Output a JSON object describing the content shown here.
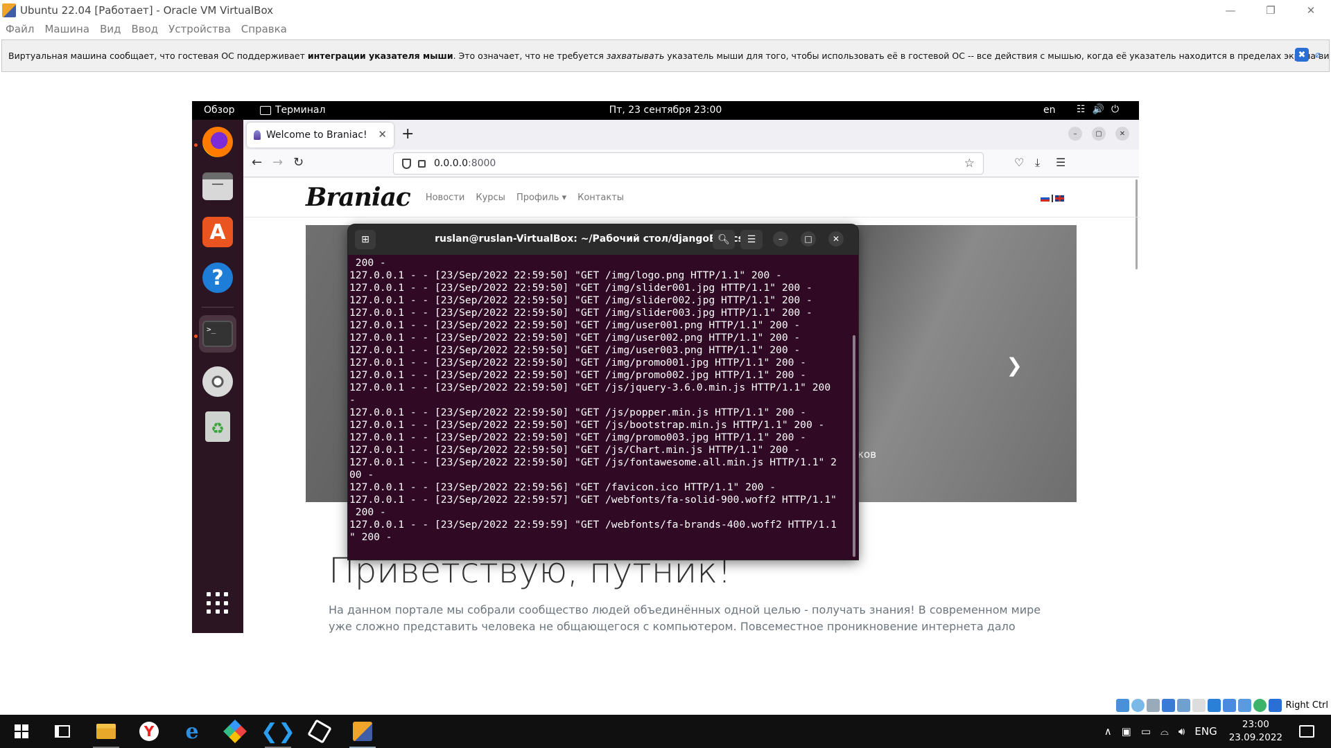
{
  "host": {
    "title": "Ubuntu 22.04 [Работает] - Oracle VM VirtualBox",
    "menu": [
      "Файл",
      "Машина",
      "Вид",
      "Ввод",
      "Устройства",
      "Справка"
    ],
    "notice": {
      "part1": "Виртуальная машина сообщает, что гостевая ОС поддерживает ",
      "bold": "интеграции указателя мыши",
      "part2": ". Это означает, что не требуется ",
      "italic": "захватывать",
      "part3": " указатель мыши для того, чтобы использовать её в гостевой ОС -- все действия с мышью, когда её указатель находится в пределах экрана виртуальной машины,"
    },
    "hostkey": "Right Ctrl"
  },
  "guest": {
    "topbar": {
      "overview": "Обзор",
      "app": "Терминал",
      "clock": "Пт, 23 сентября  23:00",
      "lang": "en"
    },
    "firefox": {
      "tab_title": "Welcome to Braniac!",
      "url_host": "0.0.0.0",
      "url_port": ":8000"
    },
    "site": {
      "logo": "Braniac",
      "nav": [
        "Новости",
        "Курсы",
        "Профиль ▾",
        "Контакты"
      ],
      "caption": "ков",
      "heading": "Приветствую, путник!",
      "lead": "На данном портале мы собрали сообщество людей объединённых одной целью - получать знания! В современном мире уже сложно представить человека не общающегося с компьютером. Повсеместное проникновение интернета дало возможность объединить людей и"
    },
    "terminal": {
      "title": "ruslan@ruslan-VirtualBox: ~/Рабочий стол/djangoBasics",
      "lines": [
        " 200 -",
        "127.0.0.1 - - [23/Sep/2022 22:59:50] \"GET /img/logo.png HTTP/1.1\" 200 -",
        "127.0.0.1 - - [23/Sep/2022 22:59:50] \"GET /img/slider001.jpg HTTP/1.1\" 200 -",
        "127.0.0.1 - - [23/Sep/2022 22:59:50] \"GET /img/slider002.jpg HTTP/1.1\" 200 -",
        "127.0.0.1 - - [23/Sep/2022 22:59:50] \"GET /img/slider003.jpg HTTP/1.1\" 200 -",
        "127.0.0.1 - - [23/Sep/2022 22:59:50] \"GET /img/user001.png HTTP/1.1\" 200 -",
        "127.0.0.1 - - [23/Sep/2022 22:59:50] \"GET /img/user002.png HTTP/1.1\" 200 -",
        "127.0.0.1 - - [23/Sep/2022 22:59:50] \"GET /img/user003.png HTTP/1.1\" 200 -",
        "127.0.0.1 - - [23/Sep/2022 22:59:50] \"GET /img/promo001.jpg HTTP/1.1\" 200 -",
        "127.0.0.1 - - [23/Sep/2022 22:59:50] \"GET /img/promo002.jpg HTTP/1.1\" 200 -",
        "127.0.0.1 - - [23/Sep/2022 22:59:50] \"GET /js/jquery-3.6.0.min.js HTTP/1.1\" 200",
        "-",
        "127.0.0.1 - - [23/Sep/2022 22:59:50] \"GET /js/popper.min.js HTTP/1.1\" 200 -",
        "127.0.0.1 - - [23/Sep/2022 22:59:50] \"GET /js/bootstrap.min.js HTTP/1.1\" 200 -",
        "127.0.0.1 - - [23/Sep/2022 22:59:50] \"GET /img/promo003.jpg HTTP/1.1\" 200 -",
        "127.0.0.1 - - [23/Sep/2022 22:59:50] \"GET /js/Chart.min.js HTTP/1.1\" 200 -",
        "127.0.0.1 - - [23/Sep/2022 22:59:50] \"GET /js/fontawesome.all.min.js HTTP/1.1\" 2",
        "00 -",
        "127.0.0.1 - - [23/Sep/2022 22:59:56] \"GET /favicon.ico HTTP/1.1\" 200 -",
        "127.0.0.1 - - [23/Sep/2022 22:59:57] \"GET /webfonts/fa-solid-900.woff2 HTTP/1.1\"",
        " 200 -",
        "127.0.0.1 - - [23/Sep/2022 22:59:59] \"GET /webfonts/fa-brands-400.woff2 HTTP/1.1",
        "\" 200 -"
      ]
    }
  },
  "taskbar": {
    "lang": "ENG",
    "time": "23:00",
    "date": "23.09.2022"
  }
}
